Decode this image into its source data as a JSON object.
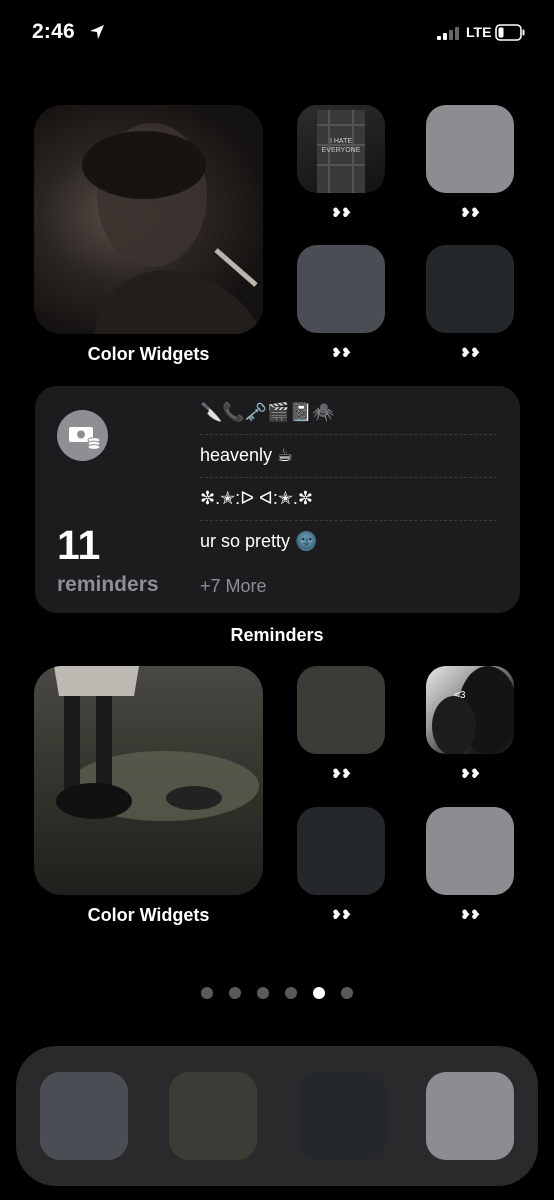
{
  "status_bar": {
    "time": "2:46",
    "network": "LTE"
  },
  "widgets": {
    "top_photo_label": "Color Widgets",
    "bottom_photo_label": "Color Widgets",
    "tile_label": "❥❥"
  },
  "reminders": {
    "icon": "money-icon",
    "count": "11",
    "count_label": "reminders",
    "items": [
      "🔪📞🗝️🎬📓🕷️",
      "heavenly ☕",
      "✼.✭:ᐅ ᐊ:✭.✼",
      "ur so pretty 🌚"
    ],
    "more": "+7 More",
    "caption": "Reminders"
  },
  "tile_colors": {
    "gray_light": "#8b8d90",
    "slate": "#4b4d55",
    "charcoal": "#25282b",
    "olive": "#3a3d35"
  },
  "page_dots": {
    "count": 6,
    "active_index": 4
  }
}
